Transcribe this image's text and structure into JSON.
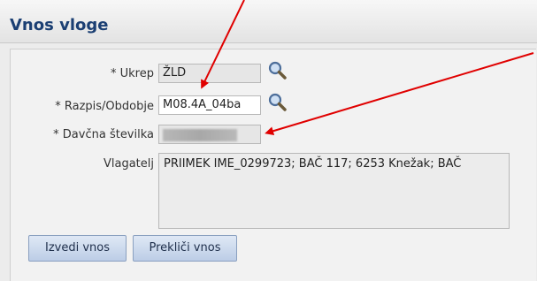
{
  "header": {
    "title": "Vnos vloge"
  },
  "form": {
    "ukrep": {
      "label": "* Ukrep",
      "value": "ŽLD"
    },
    "razpis": {
      "label": "* Razpis/Obdobje",
      "value": "M08.4A_04ba"
    },
    "davcna": {
      "label": "* Davčna številka",
      "value": ""
    },
    "vlagatelj": {
      "label": "Vlagatelj",
      "value": "PRIIMEK IME_0299723; BAČ 117; 6253 Knežak; BAČ"
    }
  },
  "buttons": {
    "submit_label": "Izvedi vnos",
    "cancel_label": "Prekliči vnos"
  },
  "icons": {
    "lookup": "magnifier-icon"
  },
  "colors": {
    "title": "#1b3f73",
    "annotation_arrow": "#e00000",
    "button_bg": "#c9d7ec"
  }
}
